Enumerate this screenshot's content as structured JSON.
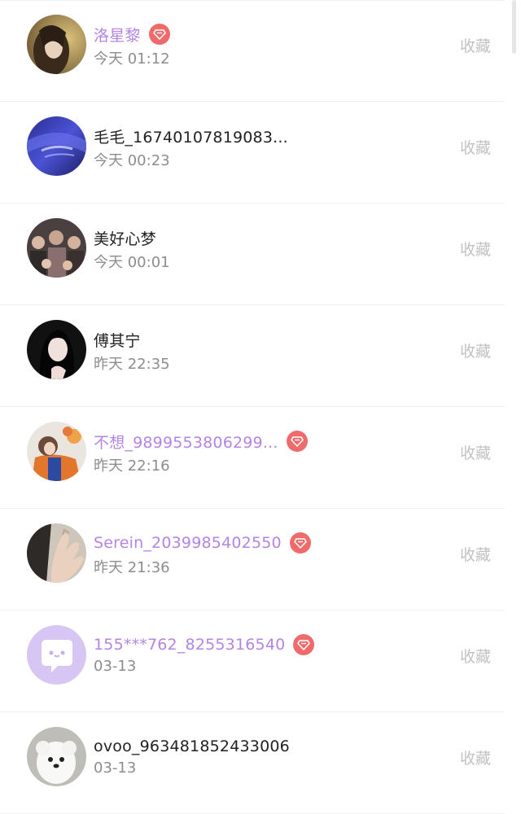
{
  "favorite_label": "收藏",
  "colors": {
    "vip_name": "#b484e6",
    "badge": "#ef6b6b",
    "normal_name": "#222222",
    "time": "#8d8d8d",
    "favorite": "#c2c2c2"
  },
  "users": [
    {
      "name": "洛星黎",
      "time": "今天 01:12",
      "vip": true
    },
    {
      "name": "毛毛_16740107819083...",
      "time": "今天 00:23",
      "vip": false
    },
    {
      "name": "美好心梦",
      "time": "今天 00:01",
      "vip": false
    },
    {
      "name": "傅其宁",
      "time": "昨天 22:35",
      "vip": false
    },
    {
      "name": "不想_9899553806299...",
      "time": "昨天 22:16",
      "vip": true
    },
    {
      "name": "Serein_2039985402550",
      "time": "昨天 21:36",
      "vip": true
    },
    {
      "name": "155***762_8255316540",
      "time": "03-13",
      "vip": true
    },
    {
      "name": "ovoo_963481852433006",
      "time": "03-13",
      "vip": false
    }
  ]
}
